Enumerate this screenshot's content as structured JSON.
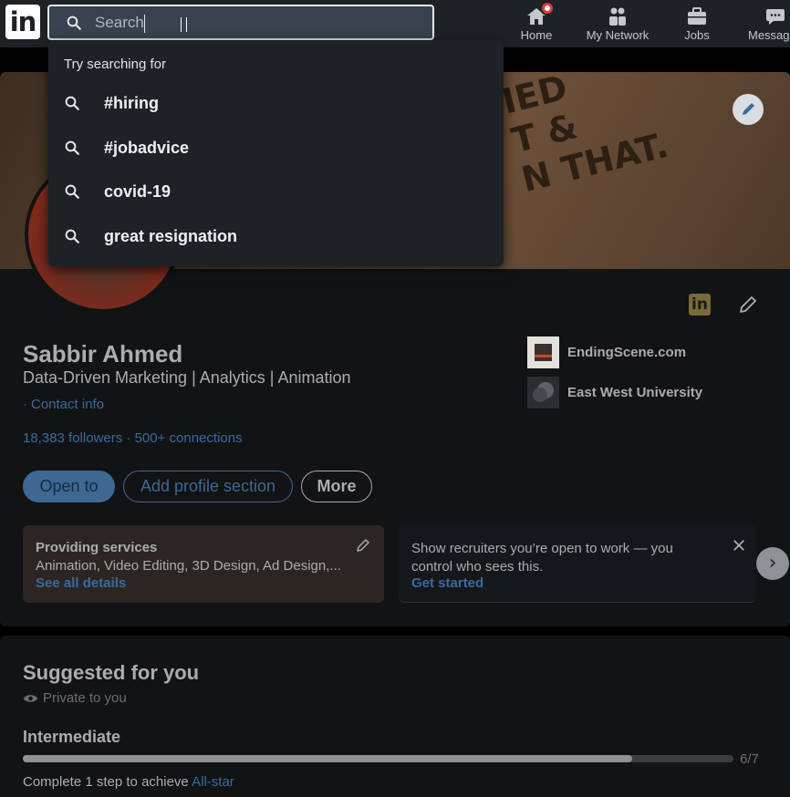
{
  "nav": {
    "logo_text": "in",
    "search_placeholder": "Search",
    "items": [
      {
        "label": "Home",
        "icon": "home-icon",
        "notification": true
      },
      {
        "label": "My Network",
        "icon": "network-icon"
      },
      {
        "label": "Jobs",
        "icon": "briefcase-icon"
      },
      {
        "label": "Messaging",
        "icon": "chat-icon"
      }
    ]
  },
  "dropdown": {
    "heading": "Try searching for",
    "suggestions": [
      "#hiring",
      "#jobadvice",
      "covid-19",
      "great resignation"
    ]
  },
  "banner": {
    "text_lines": [
      "IED",
      "T &",
      "N THAT."
    ]
  },
  "profile": {
    "li_badge": "in",
    "name": "Sabbir Ahmed",
    "headline": "Data-Driven Marketing | Analytics | Animation",
    "contact_dot": "·",
    "contact_label": "Contact info",
    "followers": "18,383 followers",
    "stat_sep": " · ",
    "connections": "500+ connections",
    "orgs": [
      {
        "name": "EndingScene.com"
      },
      {
        "name": "East West University"
      }
    ],
    "buttons": {
      "open_to": "Open to",
      "add_section": "Add profile section",
      "more": "More"
    },
    "services": {
      "title": "Providing services",
      "detail": "Animation, Video Editing, 3D Design, Ad Design,...",
      "link": "See all details"
    },
    "recruiters": {
      "text": "Show recruiters you’re open to work — you control who sees this.",
      "link": "Get started"
    },
    "carousel_next": "›"
  },
  "suggested": {
    "title": "Suggested for you",
    "privacy": "Private to you",
    "level": "Intermediate",
    "progress": {
      "current": 6,
      "total": 7,
      "label": "6/7"
    },
    "complete_prefix": "Complete 1 step to achieve ",
    "complete_link": "All-star"
  },
  "colors": {
    "nav_bg": "#1d2226",
    "link_blue": "#3c6a9c",
    "badge_red": "#e03a3a"
  }
}
